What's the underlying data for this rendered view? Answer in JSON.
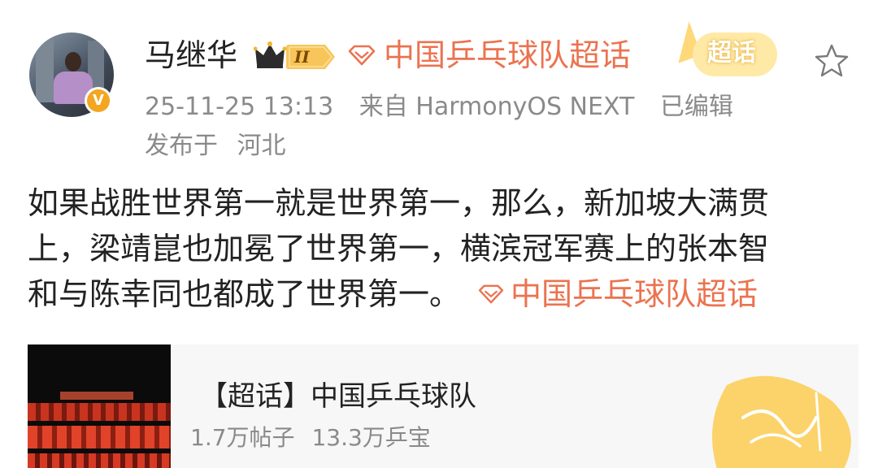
{
  "header": {
    "username": "马继华",
    "level_badge": "II",
    "topic_name": "中国乒乓球队超话",
    "sticker_text": "超话",
    "timestamp": "25-11-25 13:13",
    "source": "来自 HarmonyOS NEXT",
    "edited": "已编辑",
    "location_prefix": "发布于",
    "location": "河北"
  },
  "post": {
    "lines": [
      "如果战胜世界第一就是世界第一，那么，新加坡大满贯",
      "上，梁靖崑也加冕了世界第一，横滨冠军赛上的张本智",
      "和与陈幸同也都成了世界第一。"
    ],
    "inline_topic": "中国乒乓球队超话"
  },
  "card": {
    "title": "【超话】中国乒乓球队",
    "posts_count": "1.7万帖子",
    "fans_count": "13.3万乒宝"
  },
  "colors": {
    "accent": "#eb7350",
    "meta_gray": "#8a8a8a",
    "verified": "#f3a620"
  },
  "icons": {
    "verified": "verified-v-icon",
    "crown": "crown-icon",
    "topic": "supertopic-diamond-icon",
    "star": "star-icon"
  }
}
